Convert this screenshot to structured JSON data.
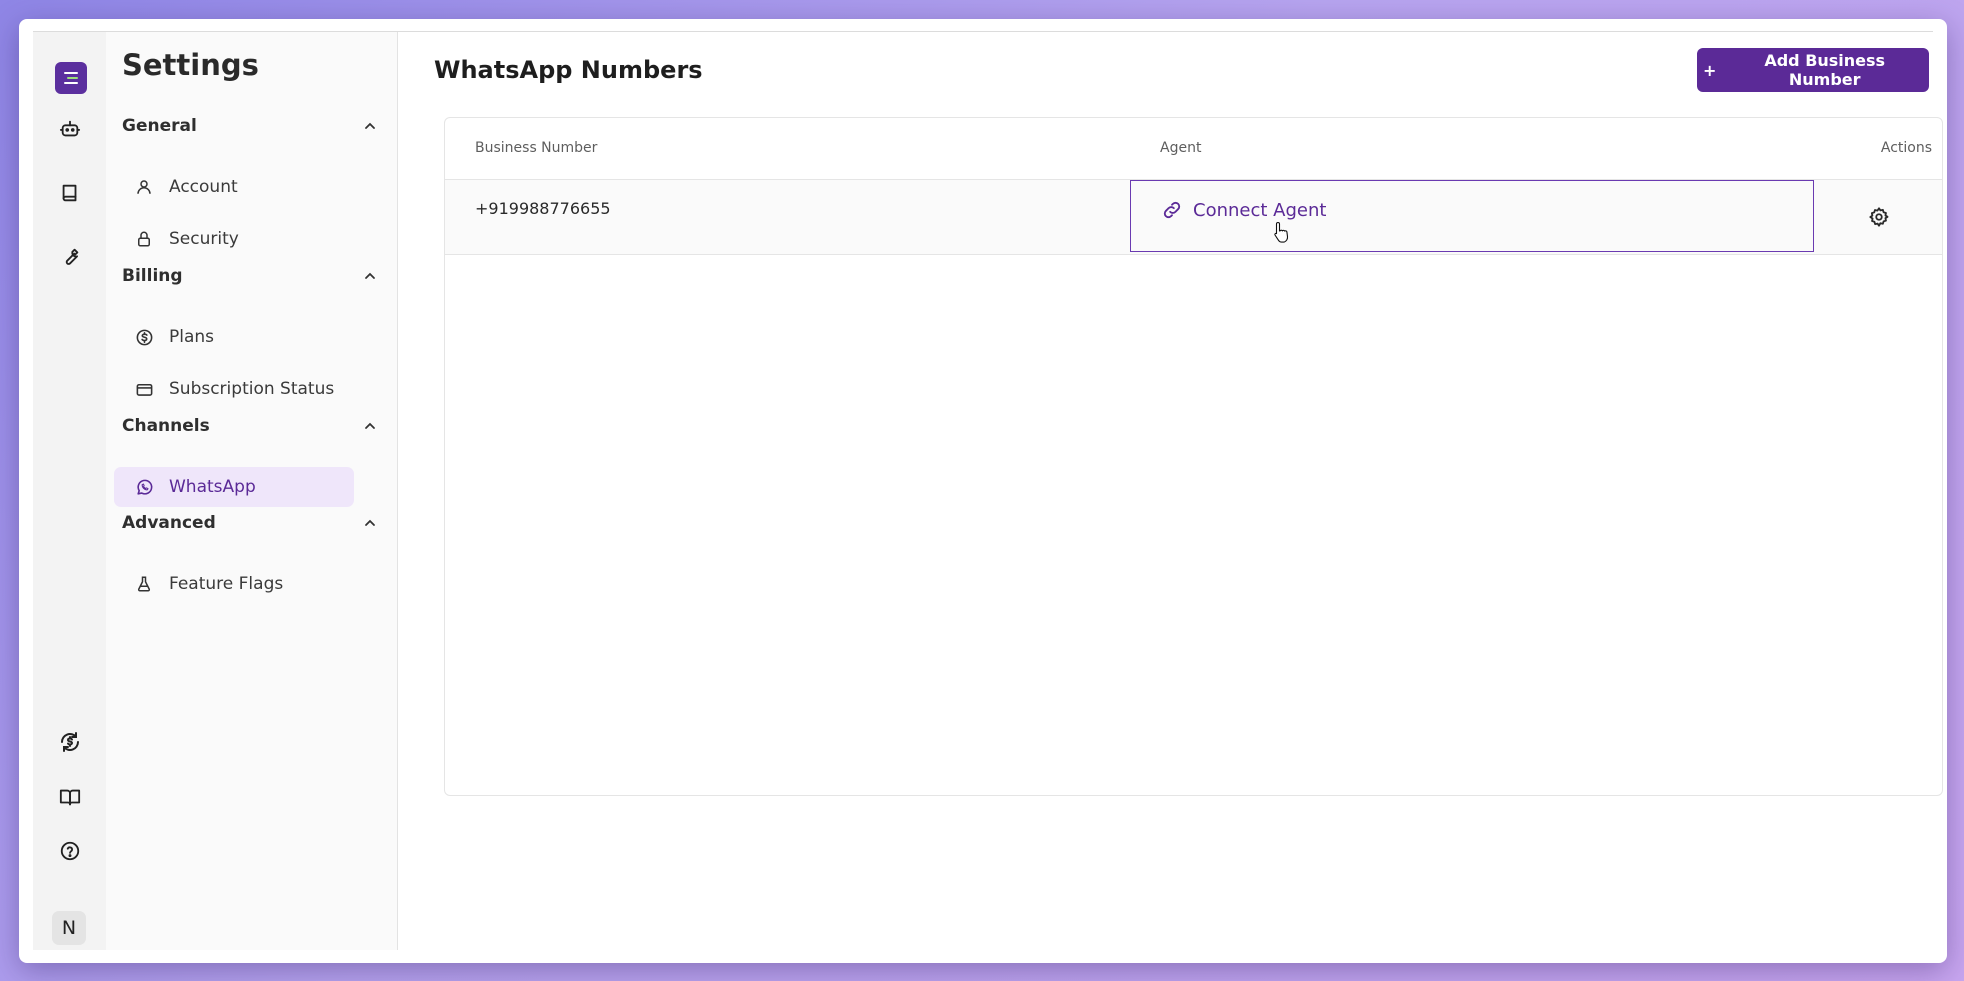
{
  "app": {
    "accent_color": "#5b2a97",
    "avatar_initial": "N"
  },
  "rail": {
    "icons": [
      "logo-icon",
      "bot-icon",
      "book-icon",
      "wrench-icon",
      "dollar-refresh-icon",
      "open-book-icon",
      "help-icon"
    ]
  },
  "sidebar": {
    "title": "Settings",
    "groups": [
      {
        "label": "General",
        "items": [
          {
            "label": "Account",
            "icon": "user-icon"
          },
          {
            "label": "Security",
            "icon": "lock-icon"
          }
        ]
      },
      {
        "label": "Billing",
        "items": [
          {
            "label": "Plans",
            "icon": "dollar-icon"
          },
          {
            "label": "Subscription Status",
            "icon": "card-icon"
          }
        ]
      },
      {
        "label": "Channels",
        "items": [
          {
            "label": "WhatsApp",
            "icon": "whatsapp-icon",
            "active": true
          }
        ]
      },
      {
        "label": "Advanced",
        "items": [
          {
            "label": "Feature Flags",
            "icon": "flask-icon"
          }
        ]
      }
    ]
  },
  "main": {
    "title": "WhatsApp Numbers",
    "add_button_label": "Add Business Number",
    "add_button_prefix": "+",
    "table": {
      "headers": [
        "Business Number",
        "Agent",
        "Actions"
      ],
      "rows": [
        {
          "number": "+919988776655",
          "agent_action": "Connect Agent"
        }
      ]
    }
  }
}
